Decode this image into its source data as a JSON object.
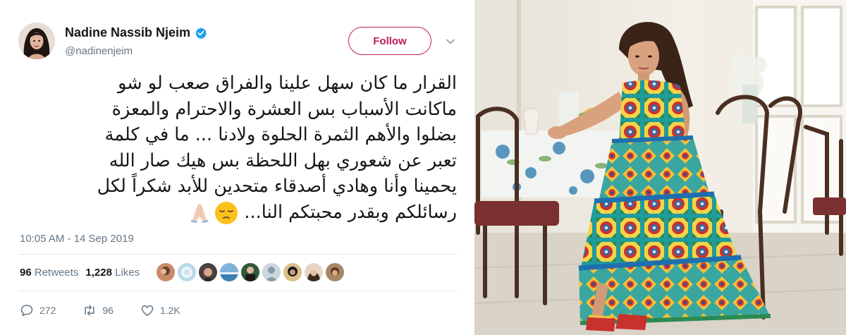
{
  "tweet": {
    "author": {
      "display_name": "Nadine Nassib Njeim",
      "handle": "@nadinenjeim",
      "verified": true,
      "verified_icon": "verified-badge-icon"
    },
    "follow_label": "Follow",
    "more_icon": "chevron-down-icon",
    "text_lines": [
      "القرار ما كان سهل علينا والفراق صعب لو شو",
      "ماكانت الأسباب بس العشرة والاحترام والمعزة",
      "بضلوا والأهم الثمرة الحلوة ولادنا ... ما في كلمة",
      "تعبر عن شعوري بهل اللحظة بس هيك صار الله",
      "يحمينا وأنا وهادي أصدقاء متحدين للأبد شكراً لكل",
      "رسائلكم وبقدر محبتكم النا..."
    ],
    "text_emojis": [
      "pensive-face-emoji",
      "folded-hands-emoji"
    ],
    "timestamp": "10:05 AM - 14 Sep 2019",
    "retweets_count": "96",
    "retweets_label": "Retweets",
    "likes_count": "1,228",
    "likes_label": "Likes",
    "likers_count": 9,
    "actions": {
      "reply_count": "272",
      "retweet_count": "96",
      "like_count": "1.2K"
    },
    "colors": {
      "follow_accent": "#c2185b",
      "verified_blue": "#1da1f2",
      "muted_text": "#657786"
    }
  },
  "photo": {
    "subject": "woman-in-patterned-dress-seated-at-table-photo"
  }
}
